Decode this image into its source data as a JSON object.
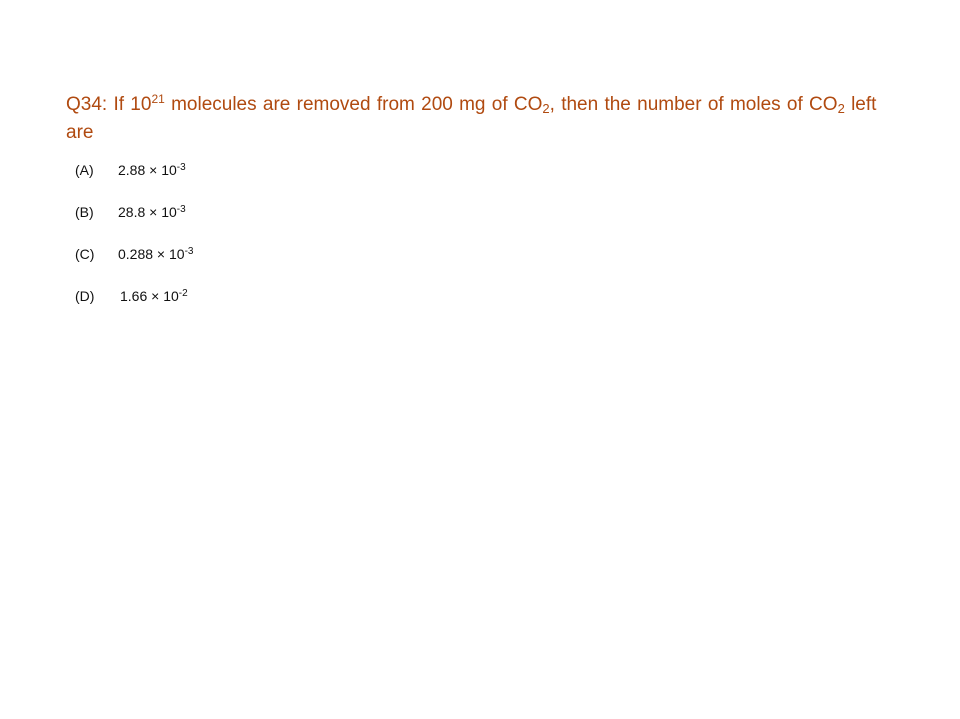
{
  "question": {
    "prefix": "Q34: If 10",
    "exp": "21",
    "mid": " molecules are removed from 200 mg of CO",
    "sub1": "2",
    "mid2": ", then the number of moles of CO",
    "sub2": "2",
    "suffix": " left are"
  },
  "options": [
    {
      "label": "(A)",
      "mantissa": "2.88 × 10",
      "exp": "-3"
    },
    {
      "label": "(B)",
      "mantissa": "28.8 × 10",
      "exp": "-3"
    },
    {
      "label": "(C)",
      "mantissa": "0.288 × 10",
      "exp": "-3"
    },
    {
      "label": "(D)",
      "mantissa": "1.66 × 10",
      "exp": "-2"
    }
  ],
  "colors": {
    "question": "#b04a10",
    "options": "#111111",
    "background": "#ffffff"
  }
}
